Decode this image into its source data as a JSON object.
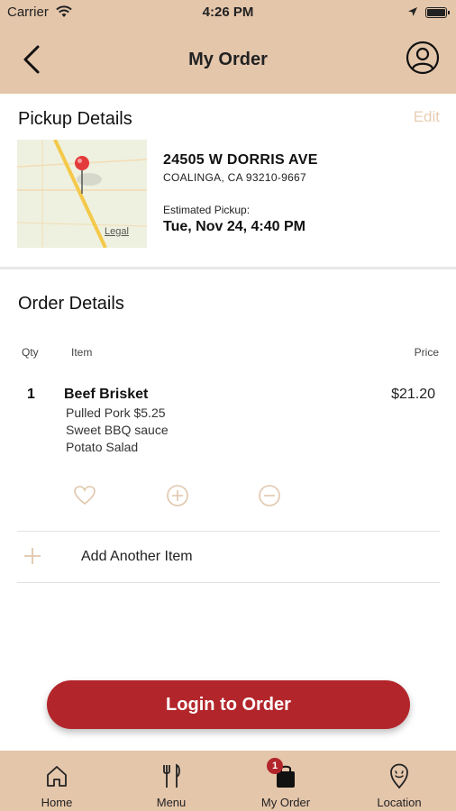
{
  "status_bar": {
    "carrier": "Carrier",
    "time": "4:26 PM"
  },
  "header": {
    "title": "My Order",
    "back_icon": "chevron-left-icon",
    "account_icon": "user-circle-icon"
  },
  "pickup": {
    "title": "Pickup Details",
    "edit_label": "Edit",
    "map_legal": "Legal",
    "address_line1": "24505 W DORRIS AVE",
    "address_line2": "COALINGA, CA 93210-9667",
    "estimated_label": "Estimated Pickup:",
    "estimated_value": "Tue, Nov 24, 4:40 PM"
  },
  "order": {
    "title": "Order Details",
    "columns": {
      "qty": "Qty",
      "item": "Item",
      "price": "Price"
    },
    "items": [
      {
        "qty": "1",
        "name": "Beef Brisket",
        "modifiers": [
          "Pulled Pork $5.25",
          "Sweet BBQ sauce",
          "Potato Salad"
        ],
        "price": "$21.20"
      }
    ],
    "add_another_label": "Add Another Item"
  },
  "login_button": "Login to Order",
  "tabbar": {
    "tabs": [
      {
        "label": "Home",
        "icon": "home-icon"
      },
      {
        "label": "Menu",
        "icon": "fork-knife-icon"
      },
      {
        "label": "My Order",
        "icon": "shopping-bag-icon",
        "badge": "1"
      },
      {
        "label": "Location",
        "icon": "map-pin-icon"
      }
    ]
  },
  "colors": {
    "accent": "#e4c6ab",
    "primary": "#b2262b",
    "muted_icon": "#e0c6ab"
  }
}
